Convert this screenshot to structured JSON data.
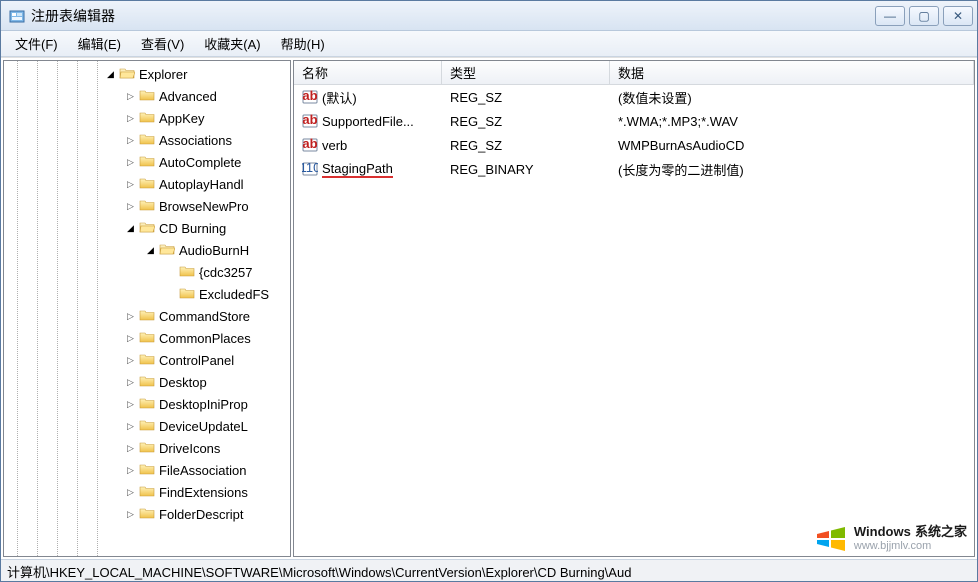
{
  "window": {
    "title": "注册表编辑器"
  },
  "menu": {
    "file": "文件(F)",
    "edit": "编辑(E)",
    "view": "查看(V)",
    "favorites": "收藏夹(A)",
    "help": "帮助(H)"
  },
  "tree": {
    "items": [
      {
        "depth": 5,
        "expand": "open",
        "label": "Explorer"
      },
      {
        "depth": 6,
        "expand": "closed",
        "label": "Advanced"
      },
      {
        "depth": 6,
        "expand": "closed",
        "label": "AppKey"
      },
      {
        "depth": 6,
        "expand": "closed",
        "label": "Associations"
      },
      {
        "depth": 6,
        "expand": "closed",
        "label": "AutoComplete"
      },
      {
        "depth": 6,
        "expand": "closed",
        "label": "AutoplayHandl"
      },
      {
        "depth": 6,
        "expand": "closed",
        "label": "BrowseNewPro"
      },
      {
        "depth": 6,
        "expand": "open",
        "label": "CD Burning"
      },
      {
        "depth": 7,
        "expand": "open",
        "label": "AudioBurnH"
      },
      {
        "depth": 8,
        "expand": "none",
        "label": "{cdc3257"
      },
      {
        "depth": 8,
        "expand": "none",
        "label": "ExcludedFS"
      },
      {
        "depth": 6,
        "expand": "closed",
        "label": "CommandStore"
      },
      {
        "depth": 6,
        "expand": "closed",
        "label": "CommonPlaces"
      },
      {
        "depth": 6,
        "expand": "closed",
        "label": "ControlPanel"
      },
      {
        "depth": 6,
        "expand": "closed",
        "label": "Desktop"
      },
      {
        "depth": 6,
        "expand": "closed",
        "label": "DesktopIniProp"
      },
      {
        "depth": 6,
        "expand": "closed",
        "label": "DeviceUpdateL"
      },
      {
        "depth": 6,
        "expand": "closed",
        "label": "DriveIcons"
      },
      {
        "depth": 6,
        "expand": "closed",
        "label": "FileAssociation"
      },
      {
        "depth": 6,
        "expand": "closed",
        "label": "FindExtensions"
      },
      {
        "depth": 6,
        "expand": "closed",
        "label": "FolderDescript"
      }
    ]
  },
  "list": {
    "headers": {
      "name": "名称",
      "type": "类型",
      "data": "数据"
    },
    "rows": [
      {
        "icon": "sz",
        "name": "(默认)",
        "type": "REG_SZ",
        "data": "(数值未设置)",
        "underline": false
      },
      {
        "icon": "sz",
        "name": "SupportedFile...",
        "type": "REG_SZ",
        "data": "*.WMA;*.MP3;*.WAV",
        "underline": false
      },
      {
        "icon": "sz",
        "name": "verb",
        "type": "REG_SZ",
        "data": "WMPBurnAsAudioCD",
        "underline": false
      },
      {
        "icon": "bin",
        "name": "StagingPath",
        "type": "REG_BINARY",
        "data": "(长度为零的二进制值)",
        "underline": true
      }
    ]
  },
  "statusbar": {
    "path": "计算机\\HKEY_LOCAL_MACHINE\\SOFTWARE\\Microsoft\\Windows\\CurrentVersion\\Explorer\\CD Burning\\Aud"
  },
  "watermark": {
    "brand": "Windows",
    "suffix": "系统之家",
    "url": "www.bjjmlv.com"
  }
}
